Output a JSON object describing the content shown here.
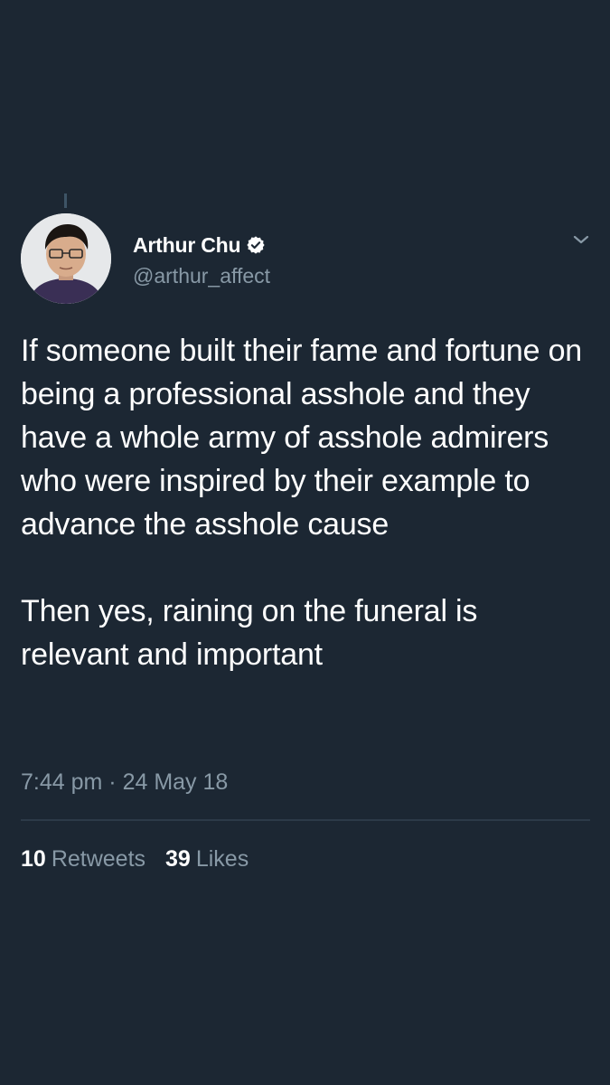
{
  "tweet": {
    "author": {
      "display_name": "Arthur Chu",
      "handle": "@arthur_affect",
      "verified": true,
      "avatar_icon": "user-avatar"
    },
    "menu_icon": "chevron-down-icon",
    "paragraphs": [
      "If someone built their fame and fortune on being a professional asshole and they have a whole army of asshole admirers who were inspired by their example to advance the asshole cause",
      "Then yes, raining on the funeral is relevant and important"
    ],
    "time": "7:44 pm",
    "separator": "·",
    "date": "24 May 18",
    "stats": {
      "retweets_count": "10",
      "retweets_label": "Retweets",
      "likes_count": "39",
      "likes_label": "Likes"
    }
  },
  "colors": {
    "background": "#1c2733",
    "text_primary": "#ffffff",
    "text_secondary": "#8899a6",
    "divider": "#2c3a48"
  }
}
